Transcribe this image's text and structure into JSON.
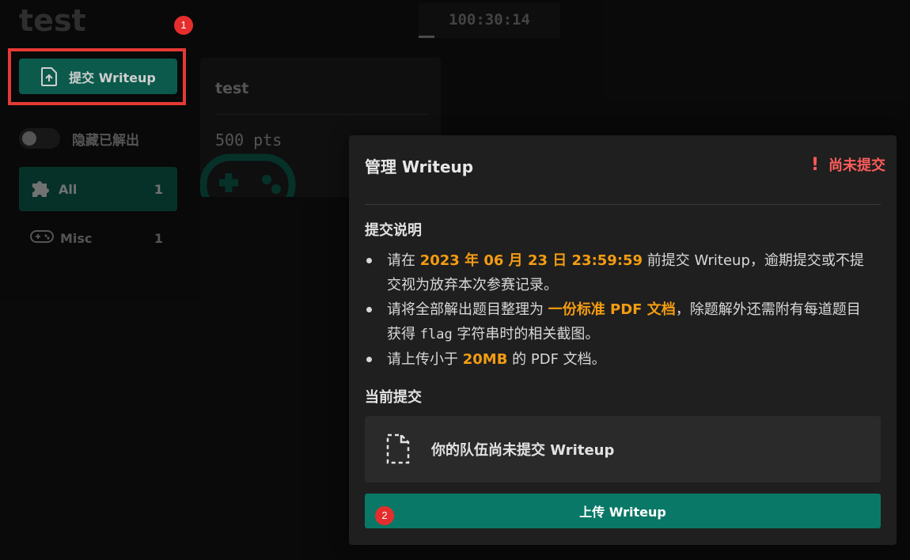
{
  "app": {
    "title": "test"
  },
  "timer": {
    "value": "100:30:14"
  },
  "sidebar": {
    "submit_label": "提交 Writeup",
    "toggle_label": "隐藏已解出",
    "categories": [
      {
        "label": "All",
        "count": "1",
        "icon": "puzzle-icon"
      },
      {
        "label": "Misc",
        "count": "1",
        "icon": "gamepad-icon"
      }
    ]
  },
  "challenge_card": {
    "title": "test",
    "points": "500 pts"
  },
  "badges": {
    "first": "1",
    "second": "2"
  },
  "modal": {
    "title": "管理 Writeup",
    "status_icon": "!",
    "status": "尚未提交",
    "instructions_heading": "提交说明",
    "items": [
      {
        "before": "请在 ",
        "highlight": "2023 年 06 月 23 日 23:59:59",
        "after": " 前提交 Writeup，逾期提交或不提交视为放弃本次参赛记录。"
      },
      {
        "before": "请将全部解出题目整理为 ",
        "highlight": "一份标准 PDF 文档",
        "after1": "，除题解外还需附有每道题目获得 ",
        "code": "flag",
        "after2": " 字符串时的相关截图。"
      },
      {
        "before": "请上传小于 ",
        "highlight": "20MB",
        "after": " 的 PDF 文档。"
      }
    ],
    "current_heading": "当前提交",
    "empty_text": "你的队伍尚未提交 Writeup",
    "upload_label": "上传 Writeup"
  },
  "colors": {
    "accent": "#0a7866",
    "warning": "#ff5b5b",
    "highlight": "#f39c12"
  }
}
